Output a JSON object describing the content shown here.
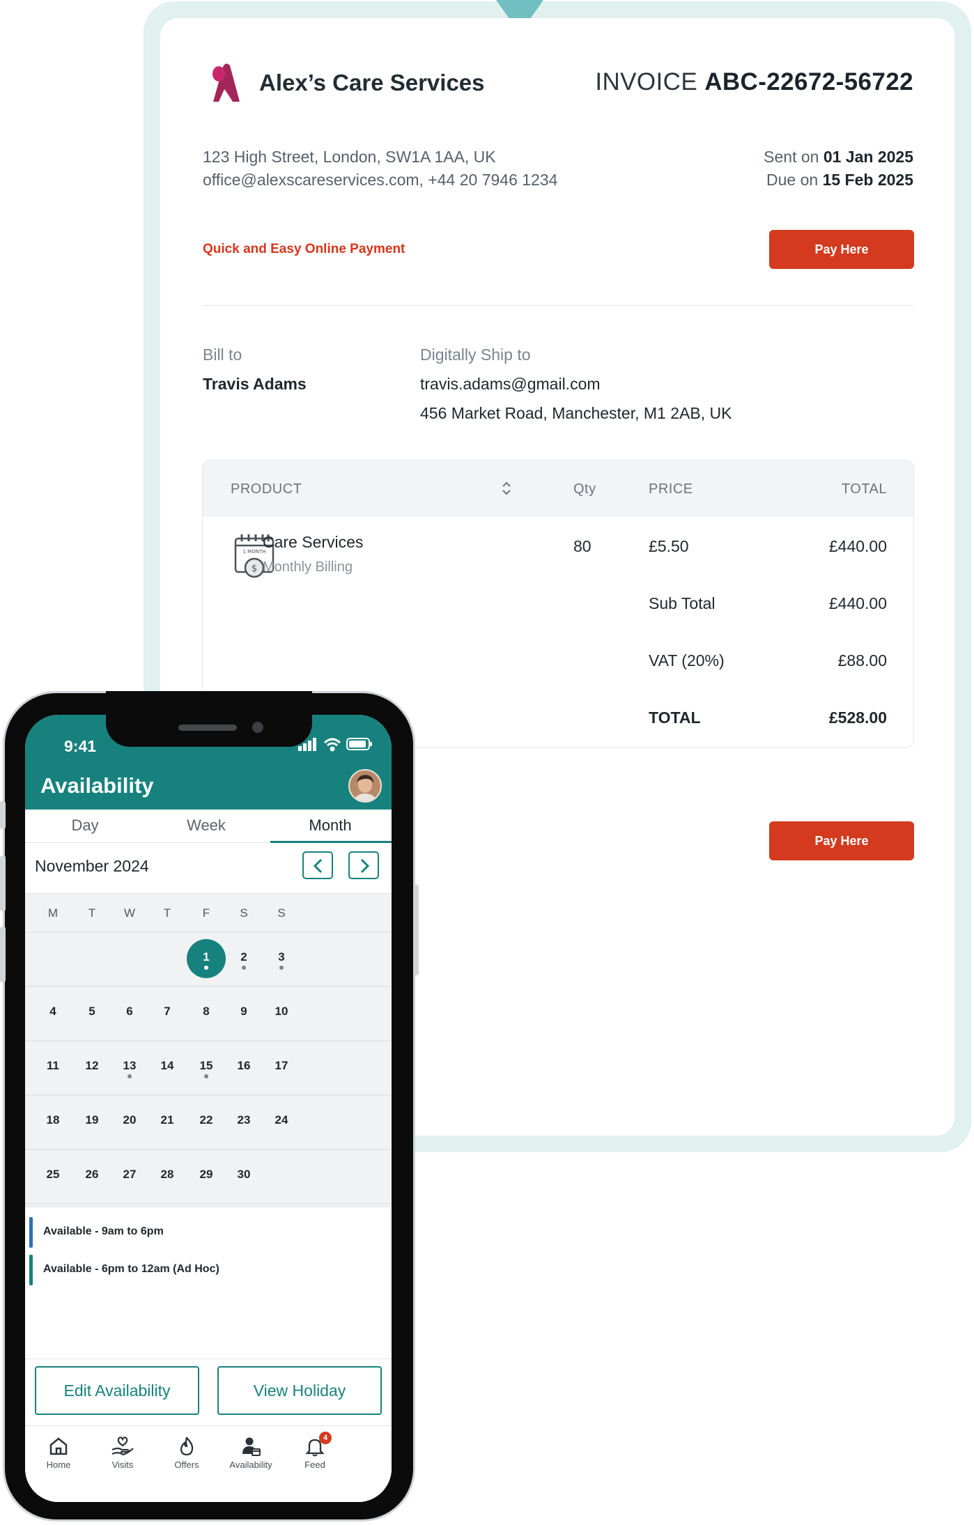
{
  "invoice": {
    "company": "Alex’s Care Services",
    "title_prefix": "INVOICE",
    "number": "ABC-22672-56722",
    "address_line1": "123 High Street, London, SW1A 1AA, UK",
    "address_line2": "office@alexscareservices.com, +44 20 7946 1234",
    "sent_label": "Sent on",
    "sent_date": "01 Jan 2025",
    "due_label": "Due on",
    "due_date": "15 Feb 2025",
    "promo": "Quick and Easy Online Payment",
    "pay_label": "Pay Here",
    "bill_to_label": "Bill to",
    "bill_to_name": "Travis Adams",
    "ship_to_label": "Digitally Ship to",
    "ship_email": "travis.adams@gmail.com",
    "ship_address": "456 Market Road, Manchester, M1 2AB, UK",
    "columns": {
      "product": "PRODUCT",
      "qty": "Qty",
      "price": "PRICE",
      "total": "TOTAL"
    },
    "item": {
      "name": "Care Services",
      "subtitle": "Monthly Billing",
      "icon_text": "1 MONTH",
      "qty": "80",
      "price": "£5.50",
      "total": "£440.00"
    },
    "summary": [
      {
        "label": "Sub Total",
        "value": "£440.00"
      },
      {
        "label": "VAT (20%)",
        "value": "£88.00"
      },
      {
        "label": "TOTAL",
        "value": "£528.00"
      }
    ]
  },
  "app": {
    "time": "9:41",
    "title": "Availability",
    "tabs": [
      "Day",
      "Week",
      "Month"
    ],
    "active_tab": "Month",
    "month": "November 2024",
    "weekdays": [
      "M",
      "T",
      "W",
      "T",
      "F",
      "S",
      "S"
    ],
    "weeks": [
      [
        "",
        "",
        "",
        "",
        "1",
        "2",
        "3"
      ],
      [
        "4",
        "5",
        "6",
        "7",
        "8",
        "9",
        "10"
      ],
      [
        "11",
        "12",
        "13",
        "14",
        "15",
        "16",
        "17"
      ],
      [
        "18",
        "19",
        "20",
        "21",
        "22",
        "23",
        "24"
      ],
      [
        "25",
        "26",
        "27",
        "28",
        "29",
        "30",
        ""
      ]
    ],
    "today": "1",
    "days_with_events": [
      "1",
      "2",
      "3",
      "13",
      "15"
    ],
    "legend": [
      {
        "label": "Available - 9am to 6pm",
        "color": "#2f6fb5"
      },
      {
        "label": "Available - 6pm to 12am (Ad Hoc)",
        "color": "#17827d"
      }
    ],
    "actions": {
      "edit": "Edit Availability",
      "holiday": "View Holiday"
    },
    "nav": [
      {
        "label": "Home",
        "icon": "home-icon"
      },
      {
        "label": "Visits",
        "icon": "visits-icon"
      },
      {
        "label": "Offers",
        "icon": "offers-icon"
      },
      {
        "label": "Availability",
        "icon": "availability-icon"
      },
      {
        "label": "Feed",
        "icon": "bell-icon",
        "badge": "4"
      }
    ],
    "colors": {
      "primary": "#17827d",
      "accent": "#d33a1e"
    }
  }
}
